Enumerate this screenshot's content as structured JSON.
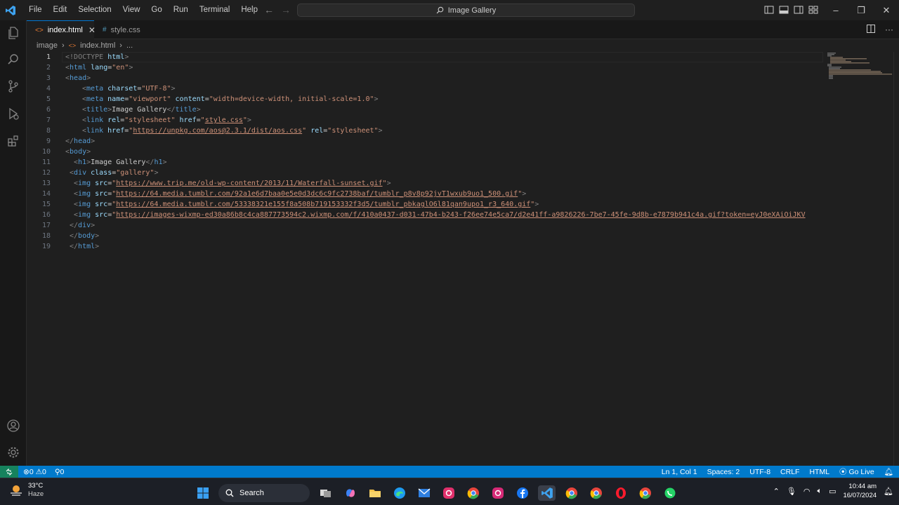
{
  "titlebar": {
    "menu": [
      "File",
      "Edit",
      "Selection",
      "View",
      "Go",
      "Run",
      "Terminal",
      "Help"
    ],
    "search_text": "Image Gallery"
  },
  "tabs": [
    {
      "label": "index.html",
      "icon": "html-file-icon",
      "active": true
    },
    {
      "label": "style.css",
      "icon": "css-file-icon",
      "active": false
    }
  ],
  "breadcrumb": {
    "folder": "image",
    "file": "index.html",
    "more": "..."
  },
  "editor": {
    "current_line": 1,
    "lines": [
      {
        "n": "1"
      },
      {
        "n": "2"
      },
      {
        "n": "3"
      },
      {
        "n": "4"
      },
      {
        "n": "5"
      },
      {
        "n": "6"
      },
      {
        "n": "7"
      },
      {
        "n": "8"
      },
      {
        "n": "9"
      },
      {
        "n": "10"
      },
      {
        "n": "11"
      },
      {
        "n": "12"
      },
      {
        "n": "13"
      },
      {
        "n": "14"
      },
      {
        "n": "15"
      },
      {
        "n": "16"
      },
      {
        "n": "17"
      },
      {
        "n": "18"
      },
      {
        "n": "19"
      }
    ],
    "code": {
      "l1_doctype": "!DOCTYPE",
      "l1_html": "html",
      "l2_tag": "html",
      "l2_attr": "lang",
      "l2_val": "\"en\"",
      "l3_tag": "head",
      "l4_tag": "meta",
      "l4_attr": "charset",
      "l4_val": "\"UTF-8\"",
      "l5_tag": "meta",
      "l5_attr1": "name",
      "l5_val1": "\"viewport\"",
      "l5_attr2": "content",
      "l5_val2": "\"width=device-width, initial-scale=1.0\"",
      "l6_tag": "title",
      "l6_text": "Image Gallery",
      "l6_close": "title",
      "l7_tag": "link",
      "l7_attr1": "rel",
      "l7_val1": "\"stylesheet\"",
      "l7_attr2": "href",
      "l7_val2_q1": "\"",
      "l7_val2": "style.css",
      "l7_val2_q2": "\"",
      "l8_tag": "link",
      "l8_attr1": "href",
      "l8_val1": "https://unpkg.com/aos@2.3.1/dist/aos.css",
      "l8_attr2": "rel",
      "l8_val2": "\"stylesheet\"",
      "l9_tag": "head",
      "l10_tag": "body",
      "l11_tag": "h1",
      "l11_text": "Image Gallery",
      "l11_close": "h1",
      "l12_tag": "div",
      "l12_attr": "class",
      "l12_val": "\"gallery\"",
      "img_tag": "img",
      "img_attr": "src",
      "l13_url": "https://www.trip.me/old-wp-content/2013/11/Waterfall-sunset.gif",
      "l14_url": "https://64.media.tumblr.com/92a1e6d7baa0e5e0d3dc6c9fc2738baf/tumblr_p8v8p92jvT1wxub9uo1_500.gif",
      "l15_url": "https://64.media.tumblr.com/53338321e155f8a508b719153332f3d5/tumblr_pbkaglO6l81qan9upo1_r3_640.gif",
      "l16_url": "https://images-wixmp-ed30a86b8c4ca887773594c2.wixmp.com/f/410a0437-d031-47b4-b243-f26ee74e5ca7/d2e41ff-a9826226-7be7-45fe-9d8b-e7879b941c4a.gif?token=eyJ0eXAiOiJKV",
      "l17_tag": "div",
      "l18_tag": "body",
      "l19_tag": "html"
    }
  },
  "statusbar": {
    "errors": "0",
    "warnings": "0",
    "ports": "0",
    "position": "Ln 1, Col 1",
    "spaces": "Spaces: 2",
    "encoding": "UTF-8",
    "eol": "CRLF",
    "language": "HTML",
    "golive": "Go Live"
  },
  "taskbar": {
    "temperature": "33°C",
    "weather": "Haze",
    "search_label": "Search",
    "time": "10:44 am",
    "date": "16/07/2024"
  },
  "colors": {
    "accent": "#0078d4",
    "statusbar": "#007acc",
    "remote": "#16825d",
    "tag": "#569cd6",
    "attr": "#9cdcfe",
    "string": "#ce9178"
  }
}
